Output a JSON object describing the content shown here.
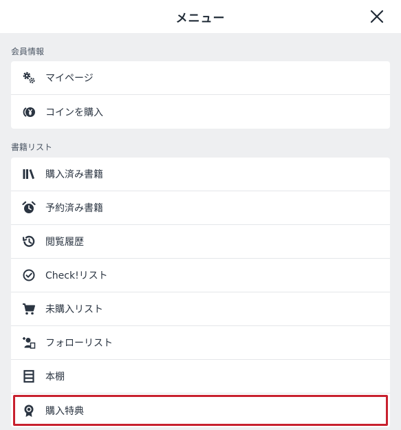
{
  "header": {
    "title": "メニュー"
  },
  "sections": {
    "member": {
      "label": "会員情報",
      "items": [
        {
          "label": "マイページ",
          "icon": "gears-icon"
        },
        {
          "label": "コインを購入",
          "icon": "coin-icon"
        }
      ]
    },
    "books": {
      "label": "書籍リスト",
      "items": [
        {
          "label": "購入済み書籍",
          "icon": "books-icon"
        },
        {
          "label": "予約済み書籍",
          "icon": "alarm-clock-icon"
        },
        {
          "label": "閲覧履歴",
          "icon": "history-icon"
        },
        {
          "label": "Check!リスト",
          "icon": "check-circle-icon"
        },
        {
          "label": "未購入リスト",
          "icon": "cart-icon"
        },
        {
          "label": "フォローリスト",
          "icon": "follow-user-icon"
        },
        {
          "label": "本棚",
          "icon": "bookshelf-icon"
        },
        {
          "label": "購入特典",
          "icon": "award-ribbon-icon"
        }
      ]
    }
  },
  "colors": {
    "highlight": "#c8202e",
    "icon": "#2b3542"
  }
}
